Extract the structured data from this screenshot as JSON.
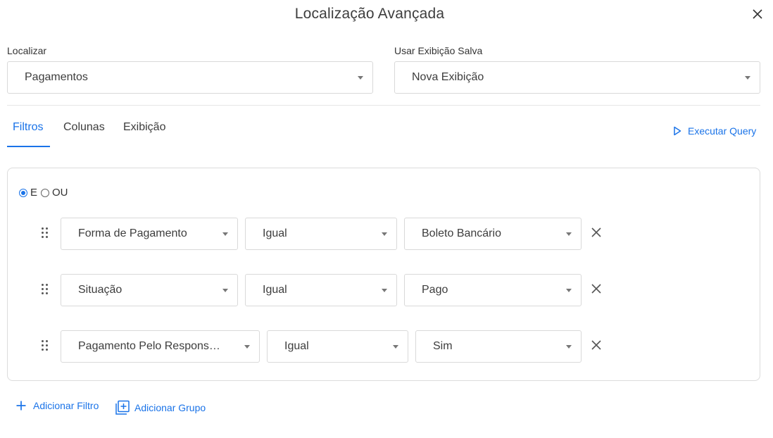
{
  "dialog": {
    "title": "Localização Avançada"
  },
  "localizar": {
    "label": "Localizar",
    "value": "Pagamentos"
  },
  "exibicao_salva": {
    "label": "Usar Exibição Salva",
    "value": "Nova Exibição"
  },
  "tabs": [
    {
      "label": "Filtros",
      "active": true
    },
    {
      "label": "Colunas",
      "active": false
    },
    {
      "label": "Exibição",
      "active": false
    }
  ],
  "execute_label": "Executar Query",
  "logic": {
    "and_label": "E",
    "or_label": "OU",
    "selected": "E"
  },
  "filters": [
    {
      "field": "Forma de Pagamento",
      "operator": "Igual",
      "value": "Boleto Bancário"
    },
    {
      "field": "Situação",
      "operator": "Igual",
      "value": "Pago"
    },
    {
      "field": "Pagamento Pelo Responsável",
      "operator": "Igual",
      "value": "Sim"
    }
  ],
  "actions": {
    "add_filter": "Adicionar Filtro",
    "add_group": "Adicionar Grupo"
  },
  "colors": {
    "accent": "#1a73e8",
    "border": "#d9d9d9",
    "text": "#3d3d3d"
  }
}
